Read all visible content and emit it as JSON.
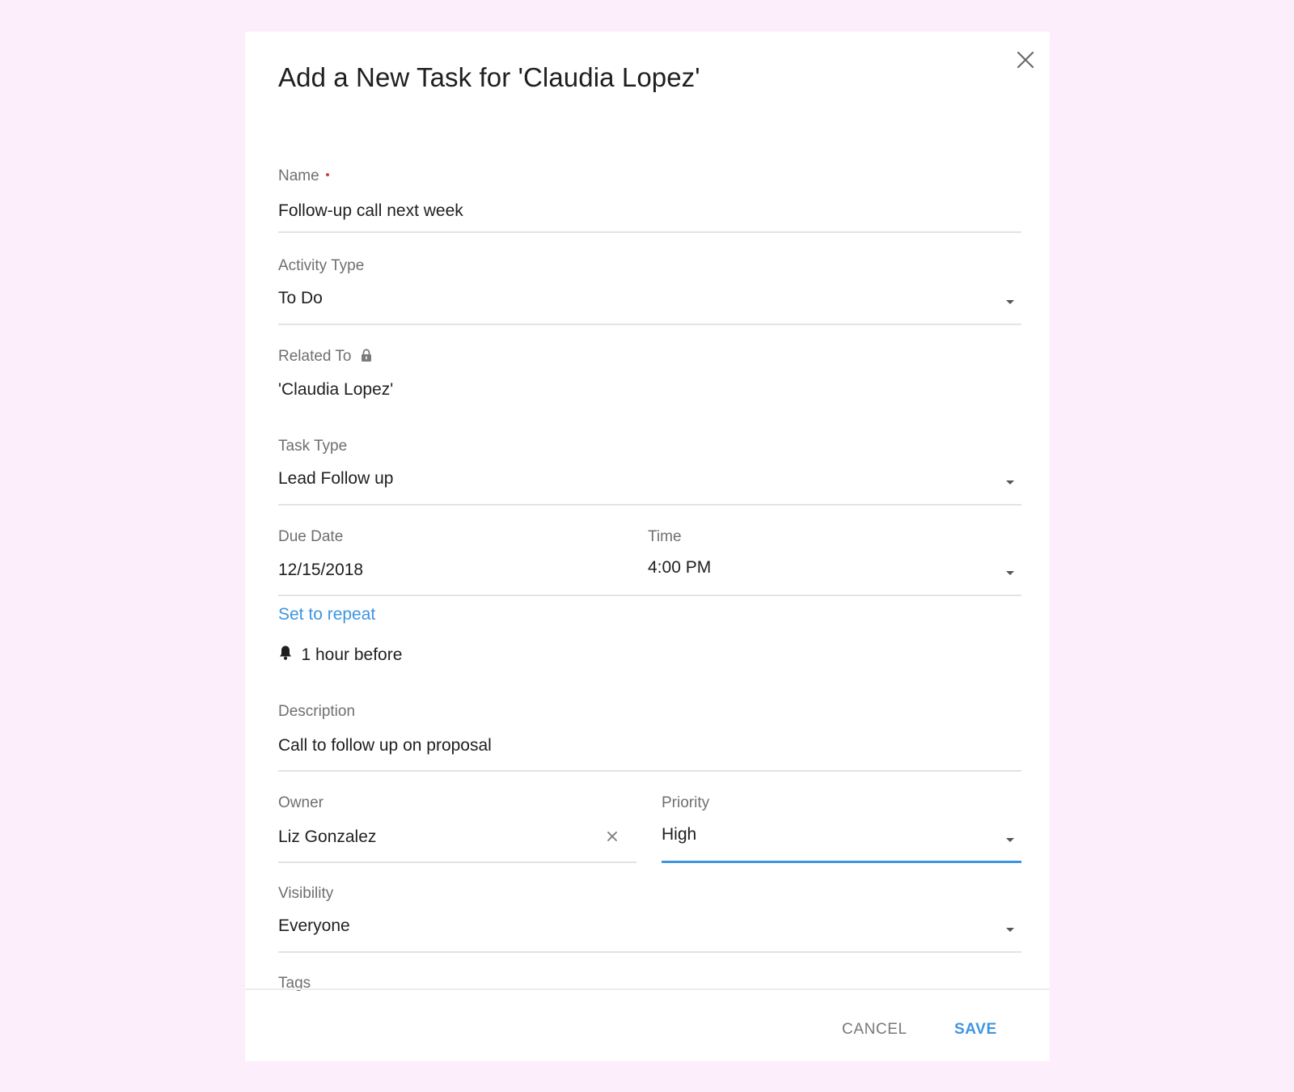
{
  "dialog": {
    "title": "Add a New Task for 'Claudia Lopez'",
    "close_icon": "close-icon"
  },
  "fields": {
    "name": {
      "label": "Name",
      "required": true,
      "value": "Follow-up call next week"
    },
    "activity_type": {
      "label": "Activity Type",
      "value": "To Do",
      "icon": "chevron-down-icon"
    },
    "related_to": {
      "label": "Related To",
      "lock_icon": "lock-icon",
      "value": "'Claudia Lopez'"
    },
    "task_type": {
      "label": "Task Type",
      "value": "Lead Follow up",
      "icon": "chevron-down-icon"
    },
    "due_date": {
      "label": "Due Date",
      "value": "12/15/2018"
    },
    "time": {
      "label": "Time",
      "value": "4:00 PM",
      "icon": "chevron-down-icon"
    },
    "repeat_link": "Set to repeat",
    "reminder": {
      "icon": "bell-icon",
      "text": "1 hour before"
    },
    "description": {
      "label": "Description",
      "value": "Call to follow up on proposal"
    },
    "owner": {
      "label": "Owner",
      "value": "Liz Gonzalez",
      "clear_icon": "clear-icon"
    },
    "priority": {
      "label": "Priority",
      "value": "High",
      "icon": "chevron-down-icon"
    },
    "visibility": {
      "label": "Visibility",
      "value": "Everyone",
      "icon": "chevron-down-icon"
    },
    "tags": {
      "label": "Tags"
    }
  },
  "footer": {
    "cancel_label": "CANCEL",
    "save_label": "SAVE"
  },
  "colors": {
    "background": "#fdeefb",
    "accent": "#3e95e0",
    "required": "#d63b3b",
    "label": "#6f6f6f",
    "text": "#202020"
  }
}
